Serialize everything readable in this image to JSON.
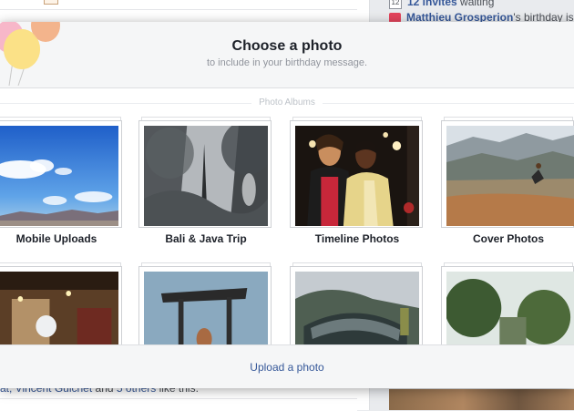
{
  "background": {
    "notice_invites": {
      "count": "12",
      "text_link": "12 invites",
      "text_rest": " waiting"
    },
    "notice_birthday": {
      "name": "Matthieu Grosperion",
      "text_rest": "'s birthday is to"
    },
    "likes_line": {
      "names": "at, Vincent Guichet",
      "and": " and ",
      "others": "5 others",
      "rest": " like this."
    }
  },
  "dialog": {
    "title": "Choose a photo",
    "subtitle": "to include in your birthday message.",
    "section_label": "Photo Albums",
    "albums": [
      {
        "label": "Mobile Uploads"
      },
      {
        "label": "Bali & Java Trip"
      },
      {
        "label": "Timeline Photos"
      },
      {
        "label": "Cover Photos"
      },
      {
        "label": ""
      },
      {
        "label": ""
      },
      {
        "label": ""
      },
      {
        "label": ""
      }
    ],
    "upload_label": "Upload a photo"
  },
  "colors": {
    "link": "#365899",
    "header_bg": "#f5f6f7",
    "border": "#dddfe2"
  }
}
